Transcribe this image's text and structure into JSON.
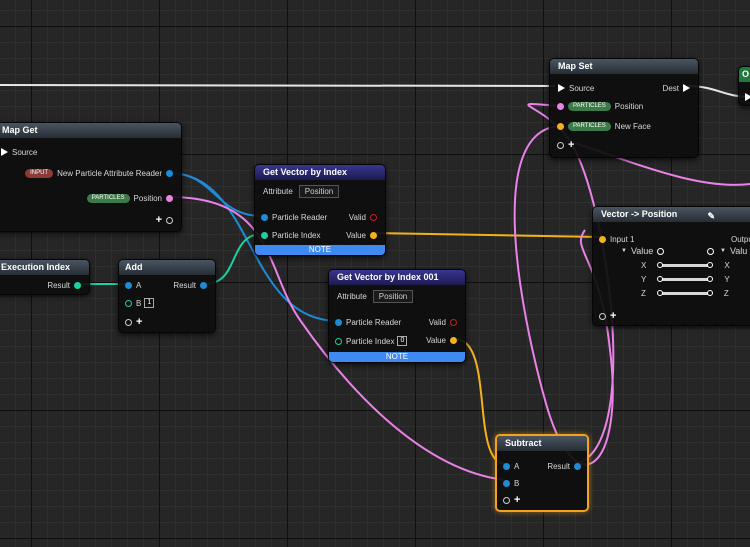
{
  "nodes": {
    "map_get": {
      "title": "Map Get",
      "source": "Source",
      "input_badge": "INPUT",
      "input_label": "New Particle Attribute Reader",
      "particles_badge": "PARTICLES",
      "particles_label": "Position"
    },
    "execution_index": {
      "title": "Execution Index",
      "result": "Result"
    },
    "add": {
      "title": "Add",
      "a": "A",
      "b": "B",
      "b_value": "1",
      "result": "Result"
    },
    "get_vector_1": {
      "title": "Get Vector by Index",
      "attribute_label": "Attribute",
      "attribute_value": "Position",
      "particle_reader": "Particle Reader",
      "particle_index": "Particle Index",
      "valid": "Valid",
      "value": "Value",
      "note": "NOTE"
    },
    "get_vector_2": {
      "title": "Get Vector by Index 001",
      "attribute_label": "Attribute",
      "attribute_value": "Position",
      "particle_reader": "Particle Reader",
      "particle_index": "Particle Index",
      "index_value": "0",
      "valid": "Valid",
      "value": "Value",
      "note": "NOTE"
    },
    "map_set": {
      "title": "Map Set",
      "source": "Source",
      "dest": "Dest",
      "badge1": "PARTICLES",
      "label1": "Position",
      "badge2": "PARTICLES",
      "label2": "New Face"
    },
    "vector_to_position": {
      "title": "Vector -> Position",
      "input_label": "Input 1",
      "output_label": "Outpu",
      "value_left": "Value",
      "value_right": "Valu",
      "x": "X",
      "y": "Y",
      "z": "Z"
    },
    "subtract": {
      "title": "Subtract",
      "a": "A",
      "b": "B",
      "result": "Result"
    },
    "partial_node": {
      "title": "O"
    }
  },
  "colors": {
    "selected_border": "#f3a21b",
    "pin_vector": "#f3b21b",
    "pin_reader": "#1d8bd8",
    "pin_int": "#1ecfa0",
    "pin_position": "#ea82e8",
    "note_bar": "#3f8af0"
  }
}
